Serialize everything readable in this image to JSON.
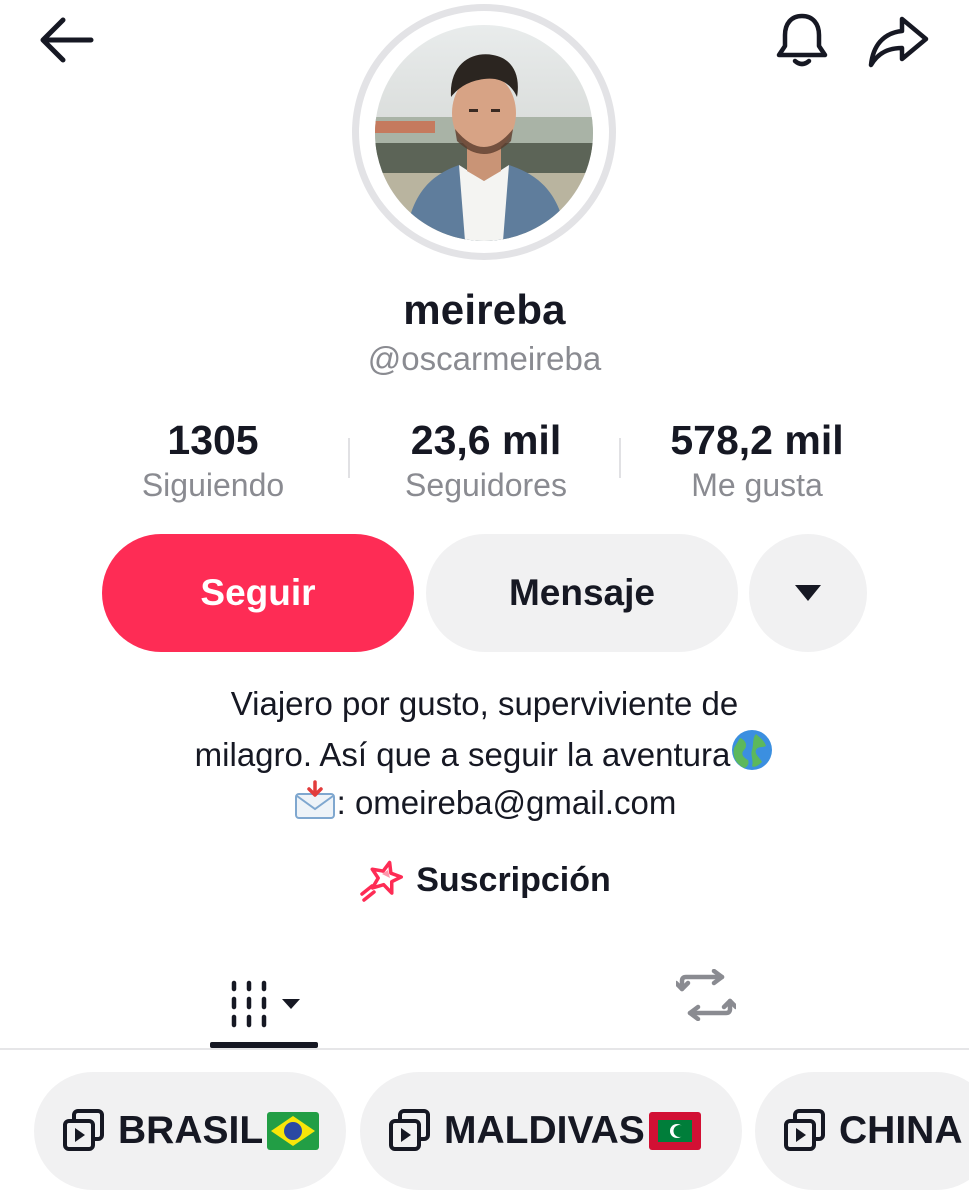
{
  "header": {
    "back_icon": "arrow-left-icon",
    "bell_icon": "bell-icon",
    "share_icon": "share-forward-icon"
  },
  "profile": {
    "avatar": "profile-photo",
    "display_name": "meireba",
    "username": "@oscarmeireba"
  },
  "stats": [
    {
      "value": "1305",
      "label": "Siguiendo"
    },
    {
      "value": "23,6 mil",
      "label": "Seguidores"
    },
    {
      "value": "578,2 mil",
      "label": "Me gusta"
    }
  ],
  "actions": {
    "follow_label": "Seguir",
    "message_label": "Mensaje",
    "more_icon": "caret-down-icon"
  },
  "bio": {
    "line1": "Viajero por gusto, superviviente de",
    "line2": "milagro. Así que a seguir la aventura",
    "line3": ": omeireba@gmail.com",
    "globe_icon": "globe-emoji",
    "mail_icon": "inbox-envelope-emoji"
  },
  "subscription": {
    "label": "Suscripción",
    "icon": "shooting-star-icon"
  },
  "tabs": [
    {
      "name": "videos",
      "icon": "grid-columns-icon",
      "active": true
    },
    {
      "name": "reposts",
      "icon": "repost-icon",
      "active": false
    }
  ],
  "playlists": [
    {
      "label": "BRASIL",
      "flag": "brazil-flag"
    },
    {
      "label": "MALDIVAS",
      "flag": "maldives-flag"
    },
    {
      "label": "CHINA"
    }
  ],
  "colors": {
    "accent": "#fe2c55",
    "chip_bg": "#f1f1f2",
    "muted_text": "#8a8b91"
  }
}
